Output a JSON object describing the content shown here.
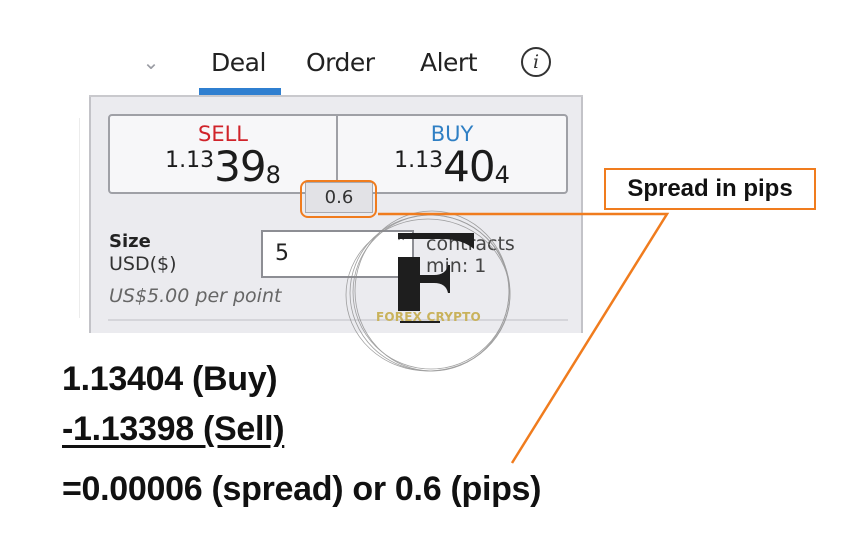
{
  "tabs": {
    "collapse_icon": "chevron-down-icon",
    "items": [
      {
        "label": "Deal",
        "active": true
      },
      {
        "label": "Order",
        "active": false
      },
      {
        "label": "Alert",
        "active": false
      }
    ],
    "info_glyph": "i",
    "active_color": "#2f7fd0"
  },
  "deal": {
    "sell": {
      "label": "SELL",
      "price_prefix": "1.13",
      "price_big": "39",
      "price_suffix": "8",
      "color": "#d0232a"
    },
    "buy": {
      "label": "BUY",
      "price_prefix": "1.13",
      "price_big": "40",
      "price_suffix": "4",
      "color": "#2f7fc4"
    },
    "spread": "0.6",
    "size": {
      "label": "Size",
      "currency": "USD($)",
      "value": "5",
      "unit": "contracts",
      "min": "min: 1",
      "per_point": "US$5.00 per point"
    }
  },
  "watermark": {
    "letter": "F",
    "text": "FOREX CRYPTO"
  },
  "annotation": {
    "callout": "Spread in pips",
    "accent_color": "#f07c1e",
    "lines": [
      "1.13404 (Buy)",
      "-1.13398 (Sell)",
      "=0.00006 (spread) or 0.6 (pips)"
    ]
  }
}
